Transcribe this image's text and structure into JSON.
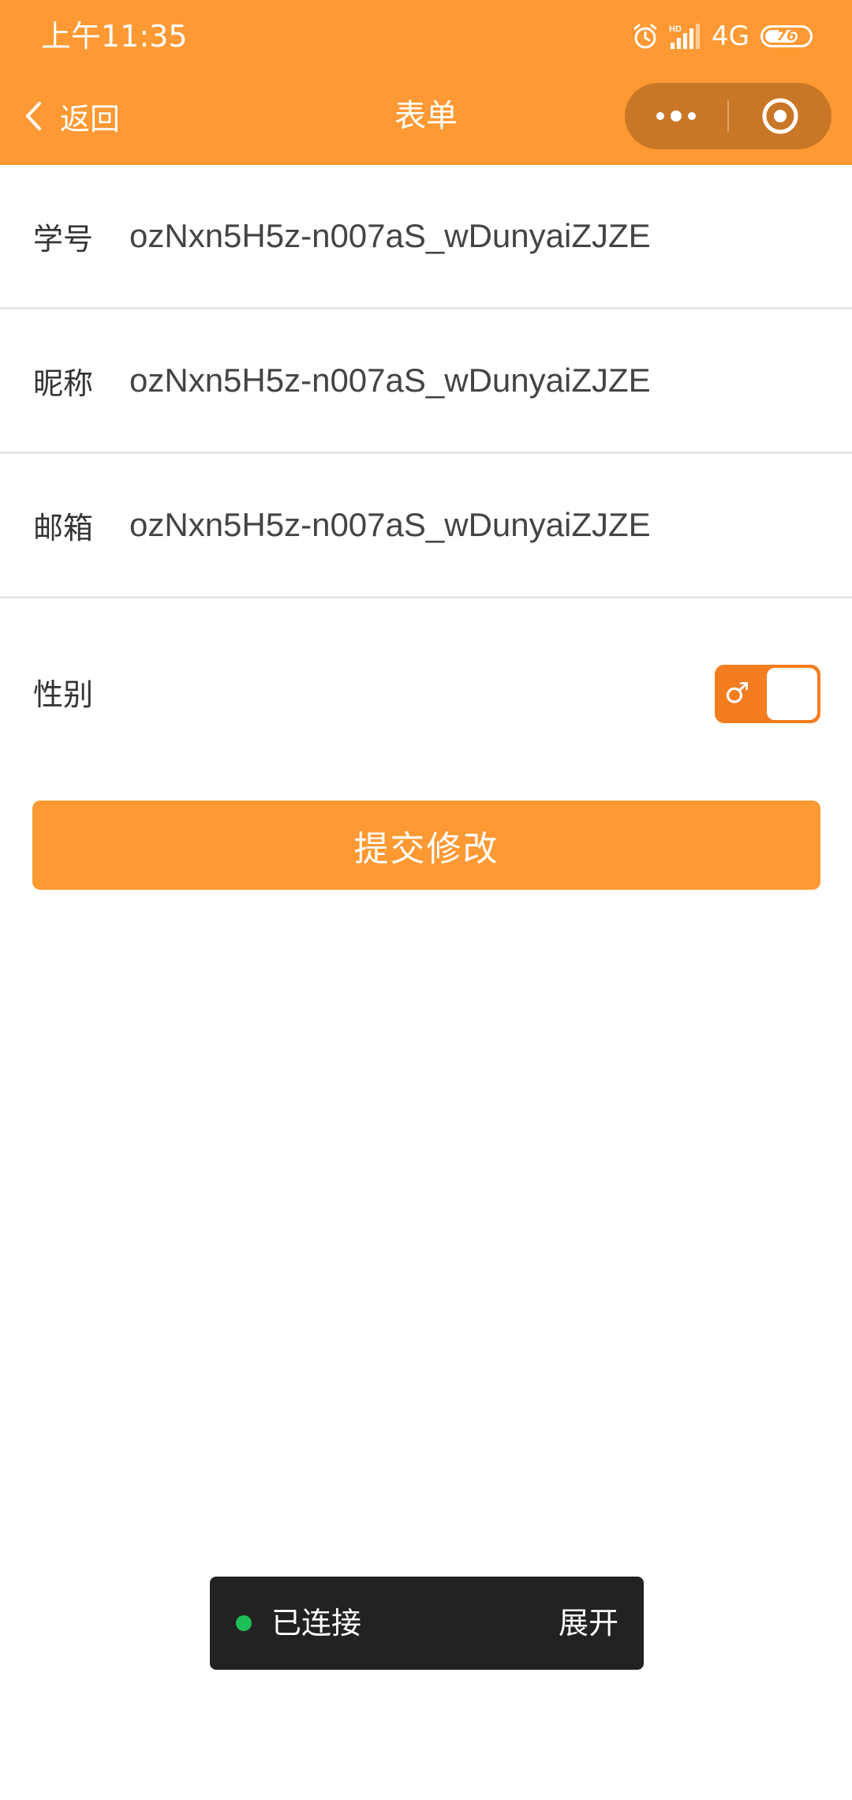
{
  "status_bar": {
    "time": "上午11:35",
    "network": "4G",
    "battery": "76",
    "battery_level": 0.76
  },
  "nav": {
    "back_label": "返回",
    "title": "表单",
    "back_icon": "chevron-left-icon",
    "more_icon": "more-dots-icon",
    "close_icon": "target-circle-icon"
  },
  "form": {
    "student_id": {
      "label": "学号",
      "value": "ozNxn5H5z-n007aS_wDunyaiZJZE"
    },
    "nickname": {
      "label": "昵称",
      "value": "ozNxn5H5z-n007aS_wDunyaiZJZE"
    },
    "email": {
      "label": "邮箱",
      "value": "ozNxn5H5z-n007aS_wDunyaiZJZE"
    },
    "gender": {
      "label": "性别",
      "symbol": "♂",
      "is_male": true
    }
  },
  "submit": {
    "label": "提交修改"
  },
  "toast": {
    "status": "已连接",
    "expand": "展开",
    "dot_color": "#1DC057"
  },
  "colors": {
    "primary": "#FF9933",
    "toggle": "#F47D20",
    "capsule": "#C97727"
  }
}
